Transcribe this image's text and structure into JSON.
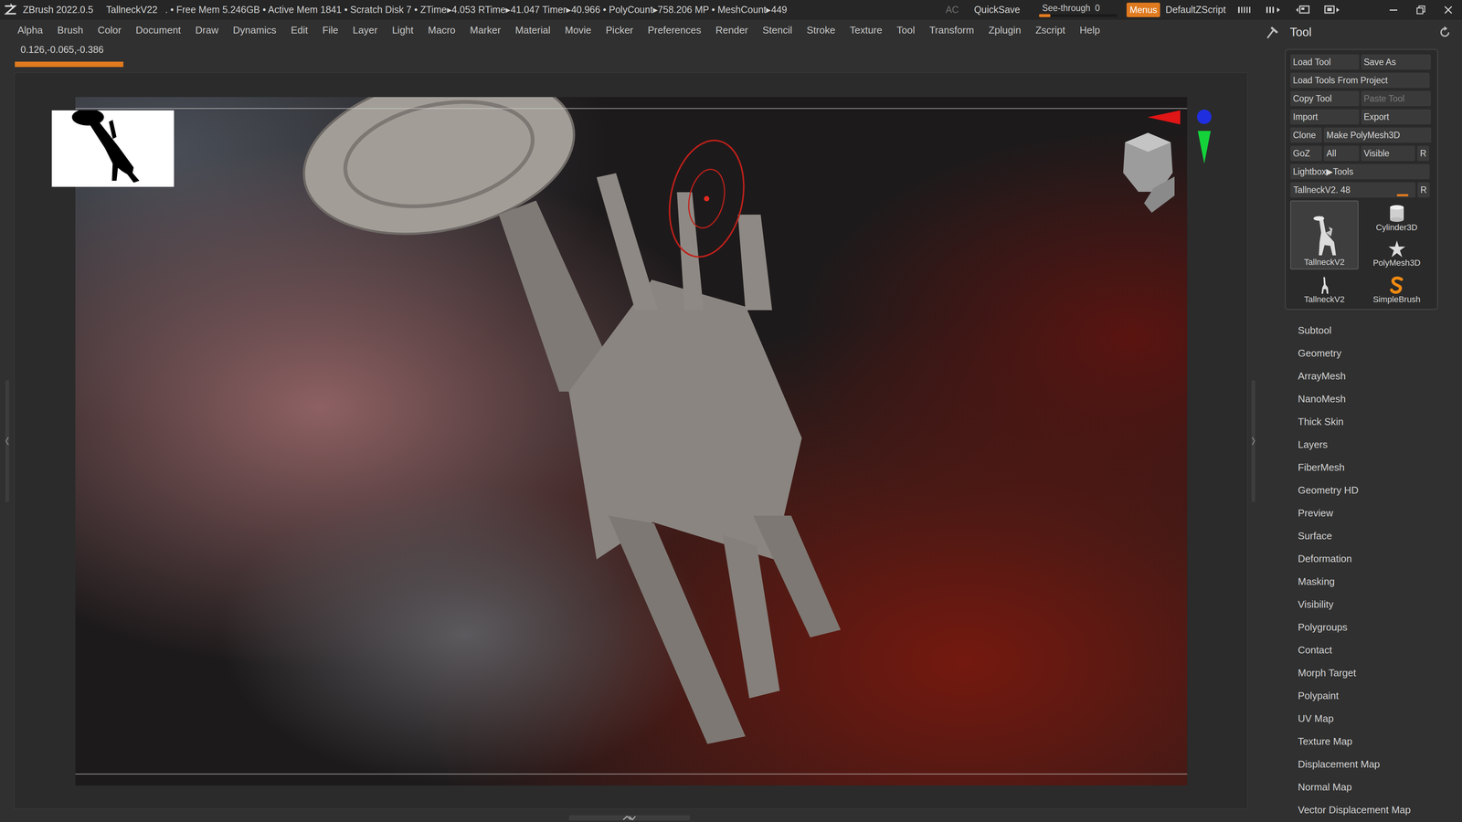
{
  "title_bar": {
    "app_name": "ZBrush 2022.0.5",
    "document": "TallneckV22",
    "stats": ". • Free Mem 5.246GB • Active Mem 1841 • Scratch Disk 7 • ZTime▸4.053 RTime▸41.047 Timer▸40.966 • PolyCount▸758.206 MP • MeshCount▸449",
    "ac": "AC",
    "quicksave": "QuickSave",
    "see_through": {
      "label": "See-through",
      "value": "0",
      "level": 0
    },
    "menus": {
      "label": "Menus",
      "selected": true
    },
    "script": "DefaultZScript"
  },
  "menu_bar": [
    "Alpha",
    "Brush",
    "Color",
    "Document",
    "Draw",
    "Dynamics",
    "Edit",
    "File",
    "Layer",
    "Light",
    "Macro",
    "Marker",
    "Material",
    "Movie",
    "Picker",
    "Preferences",
    "Render",
    "Stencil",
    "Stroke",
    "Texture",
    "Tool",
    "Transform",
    "Zplugin",
    "Zscript",
    "Help"
  ],
  "canvas": {
    "coordinates": "0.126,-0.065,-0.386",
    "progress": {
      "level": 0.088
    }
  },
  "tool_palette": {
    "title": "Tool",
    "button_rows": [
      [
        {
          "label": "Load Tool",
          "disabled": false
        },
        {
          "label": "Save As",
          "disabled": false
        }
      ],
      [
        {
          "label": "Load Tools From Project",
          "disabled": false
        }
      ],
      [
        {
          "label": "Copy Tool",
          "disabled": false
        },
        {
          "label": "Paste Tool",
          "disabled": true
        }
      ],
      [
        {
          "label": "Import",
          "disabled": false
        },
        {
          "label": "Export",
          "disabled": false
        }
      ],
      [
        {
          "label": "Clone",
          "disabled": false
        },
        {
          "label": "Make PolyMesh3D",
          "disabled": false
        }
      ],
      [
        {
          "label": "GoZ",
          "disabled": false
        },
        {
          "label": "All",
          "disabled": false
        },
        {
          "label": "Visible",
          "disabled": false
        },
        {
          "label": "R",
          "disabled": false
        }
      ],
      [
        {
          "label": "Lightbox▶Tools",
          "disabled": false
        }
      ]
    ],
    "slider": {
      "label": "TallneckV2. 48",
      "level": 0.95,
      "reset": "R"
    },
    "tools": [
      {
        "label": "TallneckV2",
        "selected": true
      },
      {
        "label": "Cylinder3D",
        "selected": false
      },
      {
        "label": "PolyMesh3D",
        "selected": false
      },
      {
        "label": "TallneckV2",
        "selected": false
      },
      {
        "label": "SimpleBrush",
        "selected": false
      }
    ],
    "subpalettes": [
      "Subtool",
      "Geometry",
      "ArrayMesh",
      "NanoMesh",
      "Thick Skin",
      "Layers",
      "FiberMesh",
      "Geometry HD",
      "Preview",
      "Surface",
      "Deformation",
      "Masking",
      "Visibility",
      "Polygroups",
      "Contact",
      "Morph Target",
      "Polypaint",
      "UV Map",
      "Texture Map",
      "Displacement Map",
      "Normal Map",
      "Vector Displacement Map"
    ]
  }
}
